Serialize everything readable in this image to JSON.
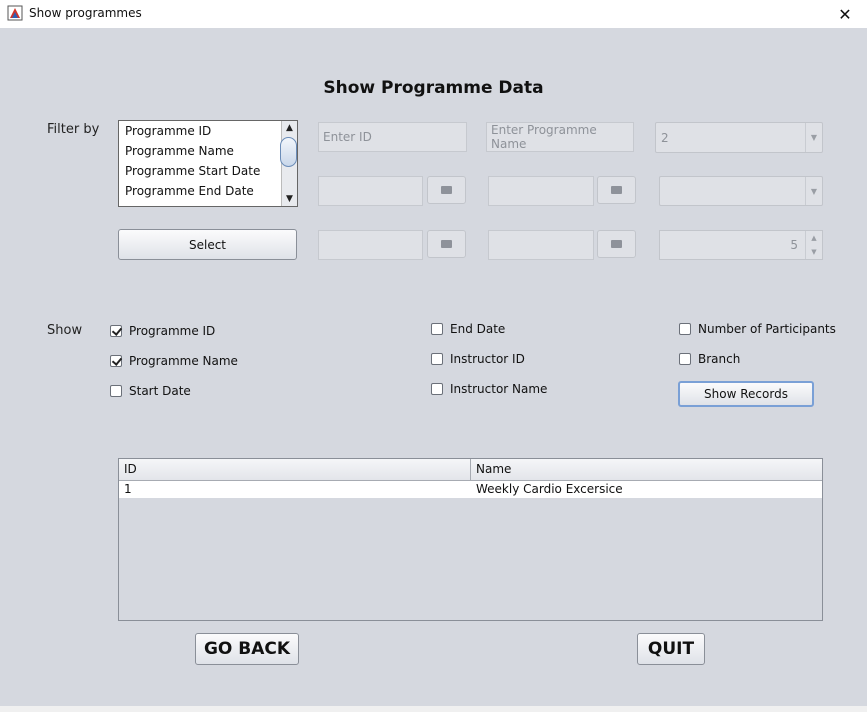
{
  "window": {
    "title": "Show programmes",
    "close_glyph": "✕",
    "icon": "app-window-icon"
  },
  "heading": "Show Programme Data",
  "filter": {
    "label": "Filter by",
    "list_items": [
      "Programme ID",
      "Programme Name",
      "Programme Start Date",
      "Programme End Date"
    ],
    "select_button": "Select",
    "id_placeholder": "Enter ID",
    "name_placeholder": "Enter Programme Name",
    "combo1_value": "2",
    "combo2_value": "",
    "spinner_value": "5"
  },
  "show": {
    "label": "Show",
    "checkboxes": [
      {
        "label": "Programme ID",
        "checked": true
      },
      {
        "label": "Programme Name",
        "checked": true
      },
      {
        "label": "Start Date",
        "checked": false
      },
      {
        "label": "End Date",
        "checked": false
      },
      {
        "label": "Instructor ID",
        "checked": false
      },
      {
        "label": "Instructor Name",
        "checked": false
      },
      {
        "label": "Number of Participants",
        "checked": false
      },
      {
        "label": "Branch",
        "checked": false
      }
    ],
    "show_records_button": "Show Records"
  },
  "table": {
    "columns": [
      "ID",
      "Name"
    ],
    "rows": [
      [
        "1",
        "Weekly Cardio Excersice"
      ]
    ]
  },
  "buttons": {
    "go_back": "GO BACK",
    "quit": "QUIT"
  }
}
